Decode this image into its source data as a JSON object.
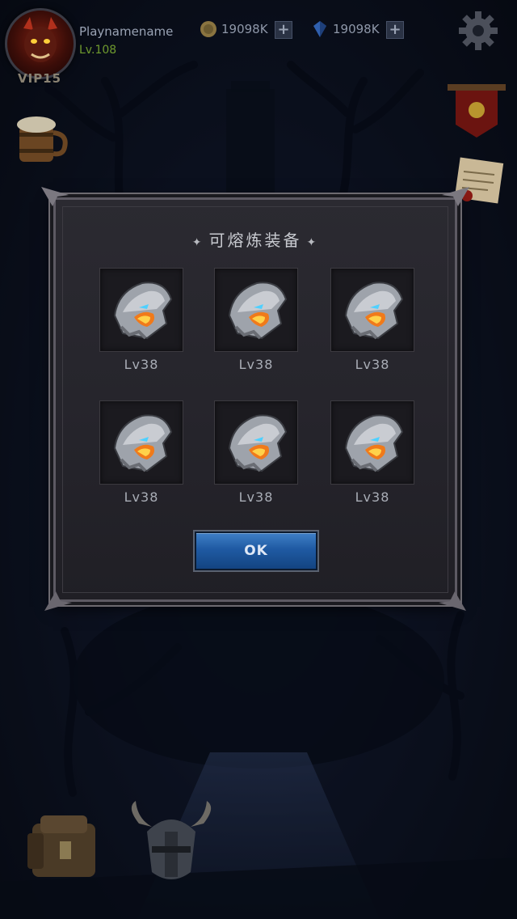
{
  "hud": {
    "player_name": "Playnamename",
    "player_level": "Lv.108",
    "vip": "VIP15",
    "coins": "19098K",
    "gems": "19098K",
    "plus_label": "+"
  },
  "dialog": {
    "title": "可熔炼装备",
    "title_deco": "✦",
    "items": [
      {
        "icon": "shoulder-armor-icon",
        "level": "Lv38"
      },
      {
        "icon": "shoulder-armor-icon",
        "level": "Lv38"
      },
      {
        "icon": "shoulder-armor-icon",
        "level": "Lv38"
      },
      {
        "icon": "shoulder-armor-icon",
        "level": "Lv38"
      },
      {
        "icon": "shoulder-armor-icon",
        "level": "Lv38"
      },
      {
        "icon": "shoulder-armor-icon",
        "level": "Lv38"
      }
    ],
    "ok_label": "OK"
  },
  "colors": {
    "accent_blue": "#1f5aa3",
    "level_green": "#6f9a2e"
  }
}
